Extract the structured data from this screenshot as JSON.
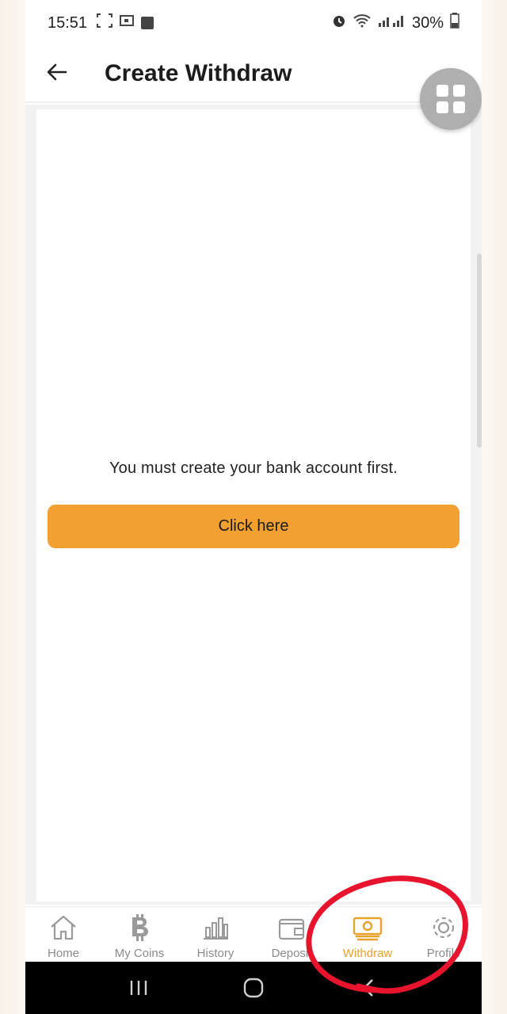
{
  "status_bar": {
    "time": "15:51",
    "battery": "30%"
  },
  "app_bar": {
    "title": "Create Withdraw",
    "back_icon": "arrow-left-icon",
    "fab_icon": "grid-icon"
  },
  "main": {
    "message": "You must create your bank account first.",
    "button_label": "Click here"
  },
  "bottom_nav": {
    "items": [
      {
        "label": "Home",
        "icon": "home-icon"
      },
      {
        "label": "My Coins",
        "icon": "bitcoin-icon"
      },
      {
        "label": "History",
        "icon": "bar-chart-icon"
      },
      {
        "label": "Deposit",
        "icon": "wallet-icon"
      },
      {
        "label": "Withdraw",
        "icon": "cash-icon",
        "active": true
      },
      {
        "label": "Profile",
        "icon": "gear-icon"
      }
    ]
  },
  "colors": {
    "accent": "#f2a031",
    "active_nav": "#e8a12d",
    "annotation": "#e8142e"
  }
}
